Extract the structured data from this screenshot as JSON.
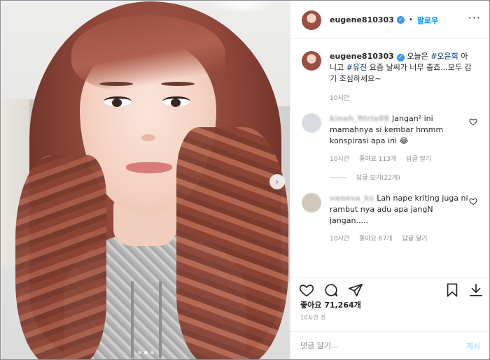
{
  "post": {
    "username": "eugene810303",
    "follow_label": "팔로우",
    "dot_sep": "•",
    "menu": "···",
    "caption": {
      "prefix": " 오늘은 ",
      "tag1": "#오윤희",
      "mid": " 아니고 ",
      "tag2": "#유진",
      "rest": " 요즘 날씨가 너무 춥죠...모두 감기 조심하세요~"
    },
    "caption_time": "10시간",
    "likes": "좋아요 71,264개",
    "posted_time": "10시간 전"
  },
  "comments": [
    {
      "user": "kinah_fitria88",
      "text": "Jangan² ini mamahnya si kembar hmmm konspirasi apa ini 😂",
      "time": "10시간",
      "likes": "좋아요 113개",
      "reply": "답글 달기"
    },
    {
      "user": "vanesa_ks",
      "text": "Lah nape kriting juga ni rambut nya adu apa jangN jangan.....",
      "time": "10시간",
      "likes": "좋아요 67개",
      "reply": "답글 달기"
    }
  ],
  "replies_label": "답글 보기(22개)",
  "comment_box": {
    "placeholder": "댓글 달기...",
    "post_label": "게시"
  },
  "carousel": {
    "arrow": "›",
    "count": 3,
    "active": 1
  },
  "colors": {
    "accent": "#0095f6",
    "verified": "#3897f0",
    "muted": "#8e8e8e",
    "post_disabled": "#b2dffc"
  },
  "icons": {
    "verified": "verified-badge-icon",
    "heart": "heart-icon",
    "comment": "comment-icon",
    "share": "share-icon",
    "save": "bookmark-icon",
    "download": "download-icon"
  }
}
